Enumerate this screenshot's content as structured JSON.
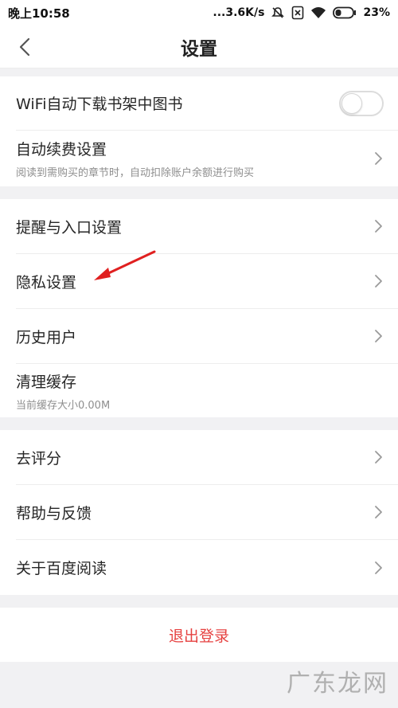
{
  "status": {
    "time": "晚上10:58",
    "speed": "...3.6K/s",
    "battery": "23%"
  },
  "nav": {
    "title": "设置"
  },
  "group1": [
    {
      "label": "WiFi自动下载书架中图书",
      "type": "toggle",
      "on": false
    },
    {
      "label": "自动续费设置",
      "sub": "阅读到需购买的章节时，自动扣除账户余额进行购买",
      "type": "link"
    }
  ],
  "group2": [
    {
      "label": "提醒与入口设置"
    },
    {
      "label": "隐私设置"
    },
    {
      "label": "历史用户"
    },
    {
      "label": "清理缓存",
      "sub": "当前缓存大小0.00M"
    }
  ],
  "group3": [
    {
      "label": "去评分"
    },
    {
      "label": "帮助与反馈"
    },
    {
      "label": "关于百度阅读"
    }
  ],
  "logout": {
    "label": "退出登录"
  },
  "watermark": "广东龙网",
  "colors": {
    "accent_red": "#e64140",
    "annotation_arrow": "#e02020"
  }
}
